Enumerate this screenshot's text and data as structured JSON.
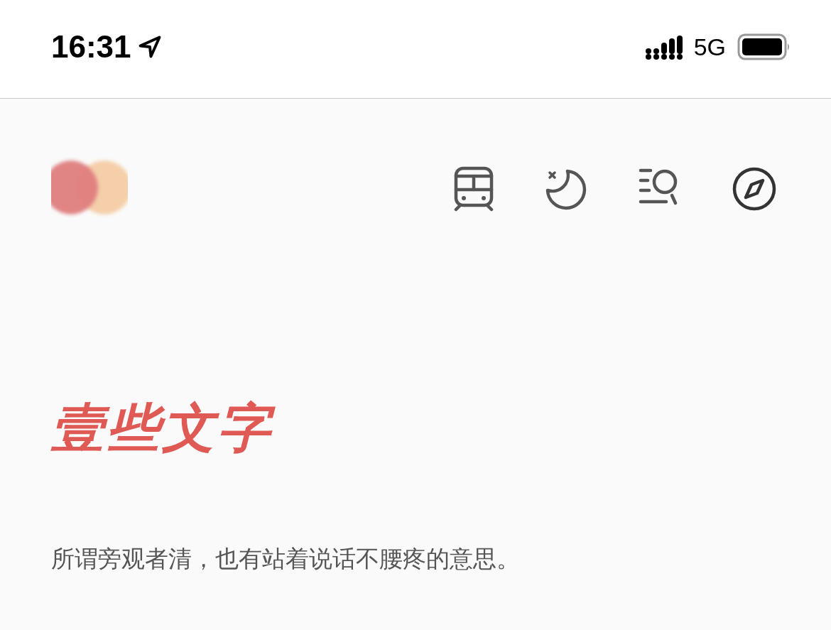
{
  "status_bar": {
    "time": "16:31",
    "network": "5G"
  },
  "header": {
    "buttons": [
      {
        "kind": "train"
      },
      {
        "kind": "moon"
      },
      {
        "kind": "search"
      },
      {
        "kind": "compass"
      }
    ]
  },
  "title": "壹些文字",
  "subtitle": "所谓旁观者清，也有站着说话不腰疼的意思。"
}
